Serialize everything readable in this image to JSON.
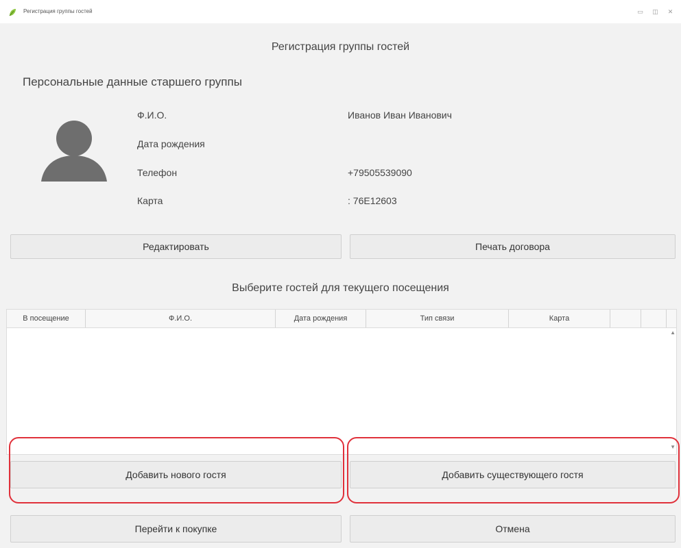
{
  "window": {
    "title": "Регистрация группы гостей"
  },
  "dialog": {
    "title": "Регистрация группы гостей",
    "section_title": "Персональные данные старшего группы",
    "fields": [
      {
        "label": "Ф.И.О.",
        "value": "Иванов Иван Иванович"
      },
      {
        "label": "Дата рождения",
        "value": ""
      },
      {
        "label": "Телефон",
        "value": "+79505539090"
      },
      {
        "label": "Карта",
        "value": ": 76E12603"
      }
    ],
    "edit_button": "Редактировать",
    "print_button": "Печать договора",
    "guests_prompt": "Выберите гостей для текущего посещения",
    "table": {
      "columns": [
        "В посещение",
        "Ф.И.О.",
        "Дата рождения",
        "Тип связи",
        "Карта",
        "",
        ""
      ],
      "rows": []
    },
    "add_new_button": "Добавить нового гостя",
    "add_existing_button": "Добавить существующего гостя",
    "purchase_button": "Перейти к покупке",
    "cancel_button": "Отмена"
  },
  "colors": {
    "highlight": "#e0303a",
    "avatar": "#6e6e6e",
    "background": "#f2f2f2"
  },
  "icons": {
    "app": "leaf-icon",
    "avatar": "user-silhouette-icon"
  }
}
